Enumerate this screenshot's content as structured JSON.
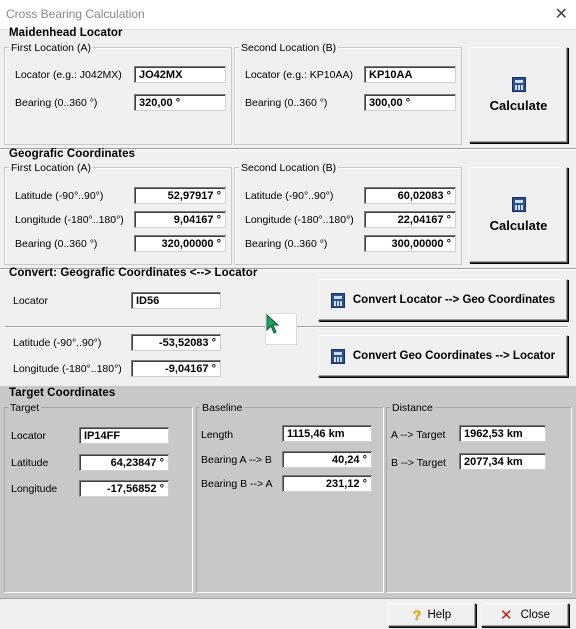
{
  "window": {
    "title": "Cross Bearing Calculation"
  },
  "maidenhead": {
    "title": "Maidenhead Locator",
    "first": {
      "legend": "First Location (A)",
      "locator_label": "Locator  (e.g.: J042MX)",
      "locator_value": "JO42MX",
      "bearing_label": "Bearing (0..360 °)",
      "bearing_value": "320,00 °"
    },
    "second": {
      "legend": "Second Location (B)",
      "locator_label": "Locator  (e.g.: KP10AA)",
      "locator_value": "KP10AA",
      "bearing_label": "Bearing (0..360 °)",
      "bearing_value": "300,00 °"
    },
    "calculate": "Calculate"
  },
  "geographic": {
    "title": "Geografic Coordinates",
    "first": {
      "legend": "First Location (A)",
      "lat_label": "Latitude (-90°..90°)",
      "lat_value": "52,97917 °",
      "lon_label": "Longitude  (-180°..180°)",
      "lon_value": "9,04167 °",
      "bearing_label": "Bearing  (0..360 °)",
      "bearing_value": "320,00000 °"
    },
    "second": {
      "legend": "Second Location (B)",
      "lat_label": "Latitude (-90°..90°)",
      "lat_value": "60,02083 °",
      "lon_label": "Longitude  (-180°..180°)",
      "lon_value": "22,04167 °",
      "bearing_label": "Bearing  (0..360 °)",
      "bearing_value": "300,00000 °"
    },
    "calculate": "Calculate"
  },
  "convert": {
    "title": "Convert: Geografic Coordinates <--> Locator",
    "locator_label": "Locator",
    "locator_value": "ID56",
    "lat_label": "Latitude (-90°..90°)",
    "lat_value": "-53,52083 °",
    "lon_label": "Longitude  (-180°..180°)",
    "lon_value": "-9,04167 °",
    "to_geo_button": "Convert Locator --> Geo Coordinates",
    "to_locator_button": "Convert Geo Coordinates --> Locator"
  },
  "target": {
    "title": "Target Coordinates",
    "target": {
      "legend": "Target",
      "locator_label": "Locator",
      "locator_value": "IP14FF",
      "lat_label": "Latitude",
      "lat_value": "64,23847 °",
      "lon_label": "Longitude",
      "lon_value": "-17,56852 °"
    },
    "baseline": {
      "legend": "Baseline",
      "length_label": "Length",
      "length_value": "1115,46 km",
      "bearing_ab_label": "Bearing A --> B",
      "bearing_ab_value": "40,24 °",
      "bearing_ba_label": "Bearing B --> A",
      "bearing_ba_value": "231,12 °"
    },
    "distance": {
      "legend": "Distance",
      "a_label": "A --> Target",
      "a_value": "1962,53 km",
      "b_label": "B --> Target",
      "b_value": "2077,34 km"
    }
  },
  "footer": {
    "help": "Help",
    "close": "Close"
  },
  "icons": {
    "close": "close-icon",
    "calculator": "calculator-icon",
    "help": "help-icon",
    "close_x": "red-x-icon",
    "cursor": "mouse-pointer-icon"
  },
  "colors": {
    "cursor_green": "#1f9e62",
    "close_red": "#c0201a",
    "help_yellow": "#e8b400",
    "grey_area": "#c8c8c8"
  }
}
